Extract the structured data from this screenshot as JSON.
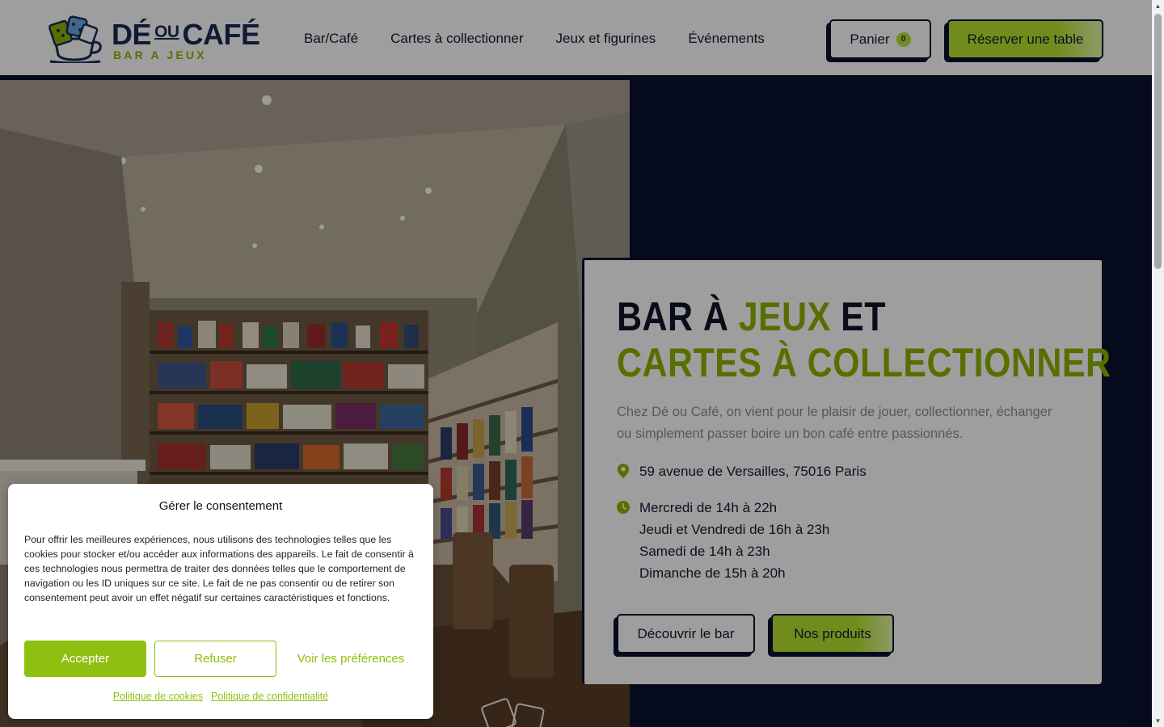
{
  "header": {
    "logo": {
      "title_main": "DÉ",
      "title_small": "OU",
      "title_end": "CAFÉ",
      "subtitle": "BAR A JEUX"
    },
    "nav": [
      {
        "label": "Bar/Café"
      },
      {
        "label": "Cartes à collectionner"
      },
      {
        "label": "Jeux et figurines"
      },
      {
        "label": "Événements"
      }
    ],
    "cart": {
      "label": "Panier",
      "count": "0"
    },
    "reserve_label": "Réserver une table"
  },
  "hero": {
    "title_line1_a": "Bar à ",
    "title_line1_accent": "jeux",
    "title_line1_b": " et",
    "title_line2_accent": "cartes à collectionner",
    "description": "Chez Dé ou Café, on vient pour le plaisir de jouer, collectionner, échanger ou simplement passer boire un bon café entre passionnés.",
    "address": "59 avenue de Versailles, 75016 Paris",
    "hours": [
      "Mercredi de 14h à 22h",
      "Jeudi et Vendredi de 16h à 23h",
      "Samedi de 14h à 23h",
      "Dimanche de 15h à 20h"
    ],
    "discover_label": "Découvrir le bar",
    "products_label": "Nos produits"
  },
  "consent": {
    "title": "Gérer le consentement",
    "text": "Pour offrir les meilleures expériences, nous utilisons des technologies telles que les cookies pour stocker et/ou accéder aux informations des appareils. Le fait de consentir à ces technologies nous permettra de traiter des données telles que le comportement de navigation ou les ID uniques sur ce site. Le fait de ne pas consentir ou de retirer son consentement peut avoir un effet négatif sur certaines caractéristiques et fonctions.",
    "accept_label": "Accepter",
    "refuse_label": "Refuser",
    "prefs_label": "Voir les préférences",
    "cookie_policy": "Politique de cookies",
    "privacy_policy": "Politique de confidentialité"
  },
  "colors": {
    "navy": "#0a1130",
    "lime": "#b7e32f",
    "lime_dark": "#8fb300",
    "consent_green": "#8fbf0f"
  },
  "icons": {
    "address": "map-pin-icon",
    "hours": "clock-icon",
    "scroll_up": "scroll-up-arrow-icon",
    "scroll_down": "scroll-down-arrow-icon"
  }
}
